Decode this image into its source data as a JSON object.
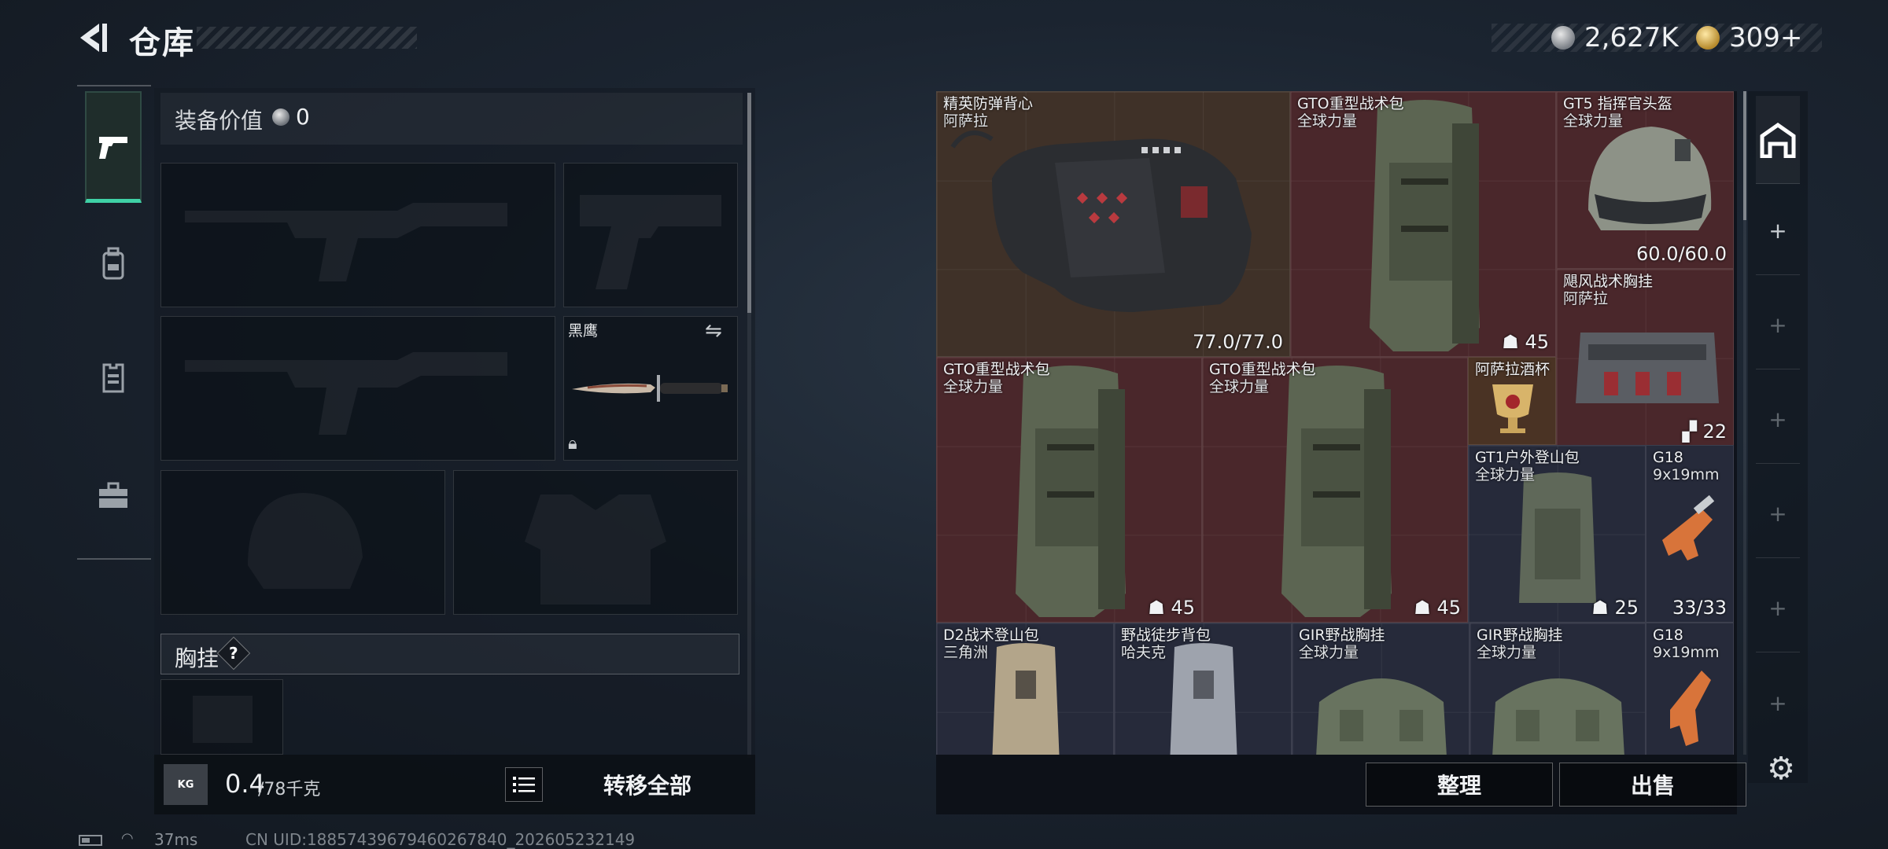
{
  "header": {
    "title": "仓库",
    "back_icon": "back-arrow-icon"
  },
  "currency": {
    "silver": "2,627K",
    "gold": "309+"
  },
  "side_nav": [
    {
      "name": "weapons",
      "icon": "pistol-icon",
      "active": true
    },
    {
      "name": "gear",
      "icon": "backpack-icon",
      "active": false
    },
    {
      "name": "vest",
      "icon": "vest-icon",
      "active": false
    },
    {
      "name": "case",
      "icon": "briefcase-icon",
      "active": false
    }
  ],
  "equipment": {
    "value_label": "装备价值",
    "value": "0",
    "melee_name": "黑鹰",
    "chest_label": "胸挂",
    "chest_help": "?",
    "weight_icon": "KG",
    "weight_current": "0.4",
    "weight_max": "/78千克",
    "transfer_all": "转移全部"
  },
  "stash": {
    "items": [
      {
        "name": "精英防弹背心",
        "sub": "阿萨拉",
        "value": "77.0/77.0"
      },
      {
        "name": "GTO重型战术包",
        "sub": "全球力量",
        "value": "45"
      },
      {
        "name": "GT5 指挥官头盔",
        "sub": "全球力量",
        "value": "60.0/60.0"
      },
      {
        "name": "飓风战术胸挂",
        "sub": "阿萨拉",
        "value": "22"
      },
      {
        "name": "GTO重型战术包",
        "sub": "全球力量",
        "value": "45"
      },
      {
        "name": "GTO重型战术包",
        "sub": "全球力量",
        "value": "45"
      },
      {
        "name": "阿萨拉酒杯",
        "sub": "",
        "value": ""
      },
      {
        "name": "GT1户外登山包",
        "sub": "全球力量",
        "value": "25"
      },
      {
        "name": "G18",
        "sub": "9x19mm",
        "value": "33/33"
      },
      {
        "name": "D2战术登山包",
        "sub": "三角洲",
        "value": ""
      },
      {
        "name": "野战徒步背包",
        "sub": "哈夫克",
        "value": ""
      },
      {
        "name": "GIR野战胸挂",
        "sub": "全球力量",
        "value": ""
      },
      {
        "name": "GIR野战胸挂",
        "sub": "全球力量",
        "value": ""
      },
      {
        "name": "G18",
        "sub": "9x19mm",
        "value": ""
      }
    ],
    "sort_label": "整理",
    "sell_label": "出售"
  },
  "status": {
    "ping": "37ms",
    "uid": "CN UID:18857439679460267840_202605232149"
  },
  "colors": {
    "accent": "#3fd1a6",
    "gold_rarity": "#4a272b",
    "purple_rarity": "#262a3a",
    "orange_rarity": "#3f3128"
  }
}
